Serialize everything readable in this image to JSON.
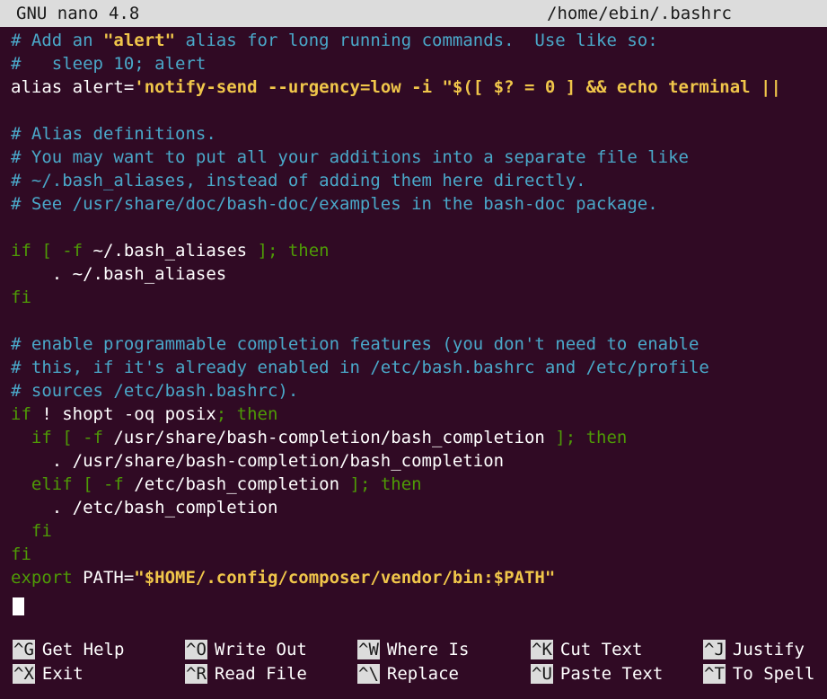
{
  "title": {
    "program": "GNU nano 4.8",
    "file": "/home/ebin/.bashrc"
  },
  "lines": [
    [
      {
        "t": "# Add an ",
        "c": "c"
      },
      {
        "t": "\"alert\"",
        "c": "s"
      },
      {
        "t": " alias for long running commands.  Use like so:",
        "c": "c"
      }
    ],
    [
      {
        "t": "#   sleep 10; alert",
        "c": "c"
      }
    ],
    [
      {
        "t": "alias alert=",
        "c": "w"
      },
      {
        "t": "'notify-send --urgency=low -i \"$([ $? = 0 ] && echo terminal ||",
        "c": "s"
      }
    ],
    [
      {
        "t": "",
        "c": "w"
      }
    ],
    [
      {
        "t": "# Alias definitions.",
        "c": "c"
      }
    ],
    [
      {
        "t": "# You may want to put all your additions into a separate file like",
        "c": "c"
      }
    ],
    [
      {
        "t": "# ~/.bash_aliases, instead of adding them here directly.",
        "c": "c"
      }
    ],
    [
      {
        "t": "# See /usr/share/doc/bash-doc/examples in the bash-doc package.",
        "c": "c"
      }
    ],
    [
      {
        "t": "",
        "c": "w"
      }
    ],
    [
      {
        "t": "if [ -f ",
        "c": "k"
      },
      {
        "t": "~/.bash_aliases",
        "c": "w"
      },
      {
        "t": " ]; then",
        "c": "k"
      }
    ],
    [
      {
        "t": "    . ~/.bash_aliases",
        "c": "w"
      }
    ],
    [
      {
        "t": "fi",
        "c": "k"
      }
    ],
    [
      {
        "t": "",
        "c": "w"
      }
    ],
    [
      {
        "t": "# enable programmable completion features (you don't need to enable",
        "c": "c"
      }
    ],
    [
      {
        "t": "# this, if it's already enabled in /etc/bash.bashrc and /etc/profile",
        "c": "c"
      }
    ],
    [
      {
        "t": "# sources /etc/bash.bashrc).",
        "c": "c"
      }
    ],
    [
      {
        "t": "if ",
        "c": "k"
      },
      {
        "t": "! shopt -oq posix",
        "c": "w"
      },
      {
        "t": "; then",
        "c": "k"
      }
    ],
    [
      {
        "t": "  if [ -f ",
        "c": "k"
      },
      {
        "t": "/usr/share/bash-completion/bash_completion",
        "c": "w"
      },
      {
        "t": " ]; then",
        "c": "k"
      }
    ],
    [
      {
        "t": "    . /usr/share/bash-completion/bash_completion",
        "c": "w"
      }
    ],
    [
      {
        "t": "  elif [ -f ",
        "c": "k"
      },
      {
        "t": "/etc/bash_completion",
        "c": "w"
      },
      {
        "t": " ]; then",
        "c": "k"
      }
    ],
    [
      {
        "t": "    . /etc/bash_completion",
        "c": "w"
      }
    ],
    [
      {
        "t": "  fi",
        "c": "k"
      }
    ],
    [
      {
        "t": "fi",
        "c": "k"
      }
    ],
    [
      {
        "t": "export ",
        "c": "k"
      },
      {
        "t": "PATH=",
        "c": "w"
      },
      {
        "t": "\"$HOME/.config/composer/vendor/bin:$PATH\"",
        "c": "s"
      }
    ]
  ],
  "shortcuts": [
    {
      "key": "^G",
      "label": "Get Help"
    },
    {
      "key": "^O",
      "label": "Write Out"
    },
    {
      "key": "^W",
      "label": "Where Is"
    },
    {
      "key": "^K",
      "label": "Cut Text"
    },
    {
      "key": "^J",
      "label": "Justify"
    },
    {
      "key": "^X",
      "label": "Exit"
    },
    {
      "key": "^R",
      "label": "Read File"
    },
    {
      "key": "^\\",
      "label": "Replace"
    },
    {
      "key": "^U",
      "label": "Paste Text"
    },
    {
      "key": "^T",
      "label": "To Spell"
    }
  ],
  "colors": {
    "background": "#300a24",
    "comment": "#4aa8c9",
    "keyword": "#4e9a06",
    "string": "#f0c64a",
    "text": "#ffffff",
    "bar": "#dcdcdc"
  }
}
